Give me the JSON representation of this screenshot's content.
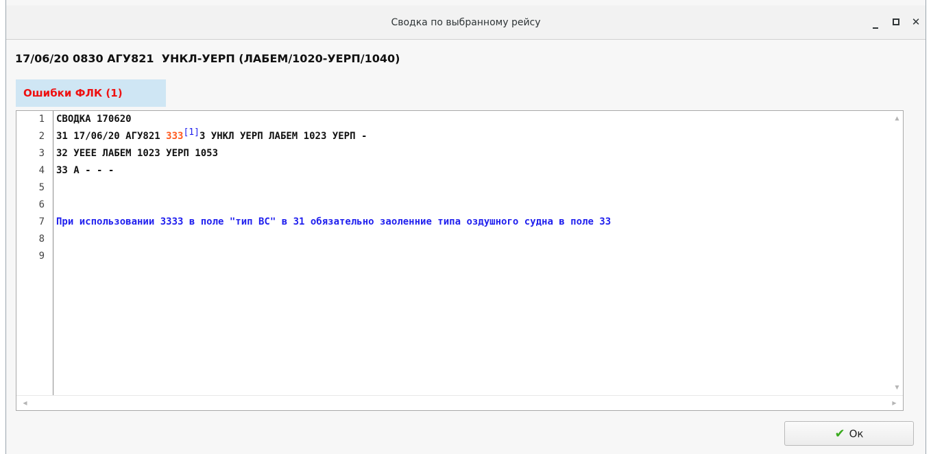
{
  "window": {
    "title": "Сводка по выбранному рейсу",
    "controls": {
      "minimize": "minimize-icon",
      "maximize": "maximize-icon",
      "close": "close-icon"
    }
  },
  "flight_header": "17/06/20 0830 АГУ821  УНКЛ-УЕРП (ЛАБЕМ/1020-УЕРП/1040)",
  "errors_tab": {
    "label": "Ошибки ФЛК (1)",
    "color": "#ee1111"
  },
  "editor": {
    "line_numbers": [
      "1",
      "2",
      "3",
      "4",
      "5",
      "6",
      "7",
      "8",
      "9"
    ],
    "lines": {
      "l1": "СВОДКА 170620",
      "l2_prefix": "31 17/06/20 АГУ821 ",
      "l2_highlight": "333",
      "l2_ref": "[1]",
      "l2_suffix": "З УНКЛ УЕРП ЛАБЕМ 1023 УЕРП -",
      "l3": "32 УЕЕЕ ЛАБЕМ 1023 УЕРП 1053",
      "l4": "33 А - - -",
      "l7": "При использовании 3333 в поле \"тип ВС\" в 31 обязательно заоленние типа оздушного судна в поле 33"
    },
    "colors": {
      "highlight": "#ff5a1f",
      "message": "#1f1fee"
    }
  },
  "ok_button": {
    "label": "Ок",
    "icon": "checkmark-icon"
  }
}
